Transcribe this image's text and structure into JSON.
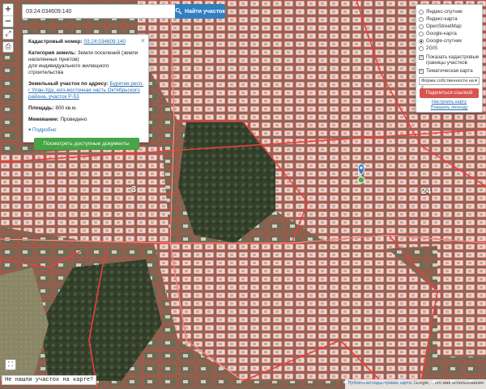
{
  "search": {
    "value": "03:24:034609:140",
    "button_label": "Найти участок"
  },
  "zoom": {
    "in_label": "+",
    "out_label": "−"
  },
  "info_panel": {
    "cadastral_label": "Кадастровый номер:",
    "cadastral_value": "03:24:034609:140",
    "category_label": "Категория земель:",
    "category_value": "Земли поселений (земли населенных пунктов)",
    "use_value": "для индивидуального жилищного строительства",
    "address_label": "Земельный участок по адресу:",
    "address_value": "Бурятия респ, г Улан-Удэ, юго-восточная часть Октябрьского района, участок Р-53",
    "area_label": "Площадь:",
    "area_value": "800 кв.м.",
    "survey_label": "Межевание:",
    "survey_value": "Проведено",
    "more_label": "Подробно",
    "docs_button": "Посмотреть доступные документы"
  },
  "layers_panel": {
    "base_layers": [
      {
        "label": "Яндекс-спутник",
        "selected": false
      },
      {
        "label": "Яндекс-карта",
        "selected": false
      },
      {
        "label": "OpenStreetMap",
        "selected": false
      },
      {
        "label": "Google-карта",
        "selected": false
      },
      {
        "label": "Google-спутник",
        "selected": true
      },
      {
        "label": "2GIS",
        "selected": false
      }
    ],
    "overlays": [
      {
        "label": "Показать кадастровые границы участков",
        "checked": true
      },
      {
        "label": "Тематическая карта",
        "checked": true
      }
    ],
    "select_value": "Форма собственности на у",
    "share_button": "Поделиться ссылкой",
    "link_print": "Настроить карту",
    "link_legend": "Показать легенду"
  },
  "map_labels": [
    "3",
    "24"
  ],
  "bottom": {
    "notfound": "Не нашли участок на карте?",
    "attribution_link": "Публичная кадастровая карта",
    "attribution_rest": "Google, ...ого имя использования"
  },
  "colors": {
    "boundary": "#e8403c",
    "parcel_fill": "#f4d9d4",
    "accent_blue": "#2f7fc1",
    "docs_green": "#47a447",
    "share_red": "#d9534f"
  }
}
